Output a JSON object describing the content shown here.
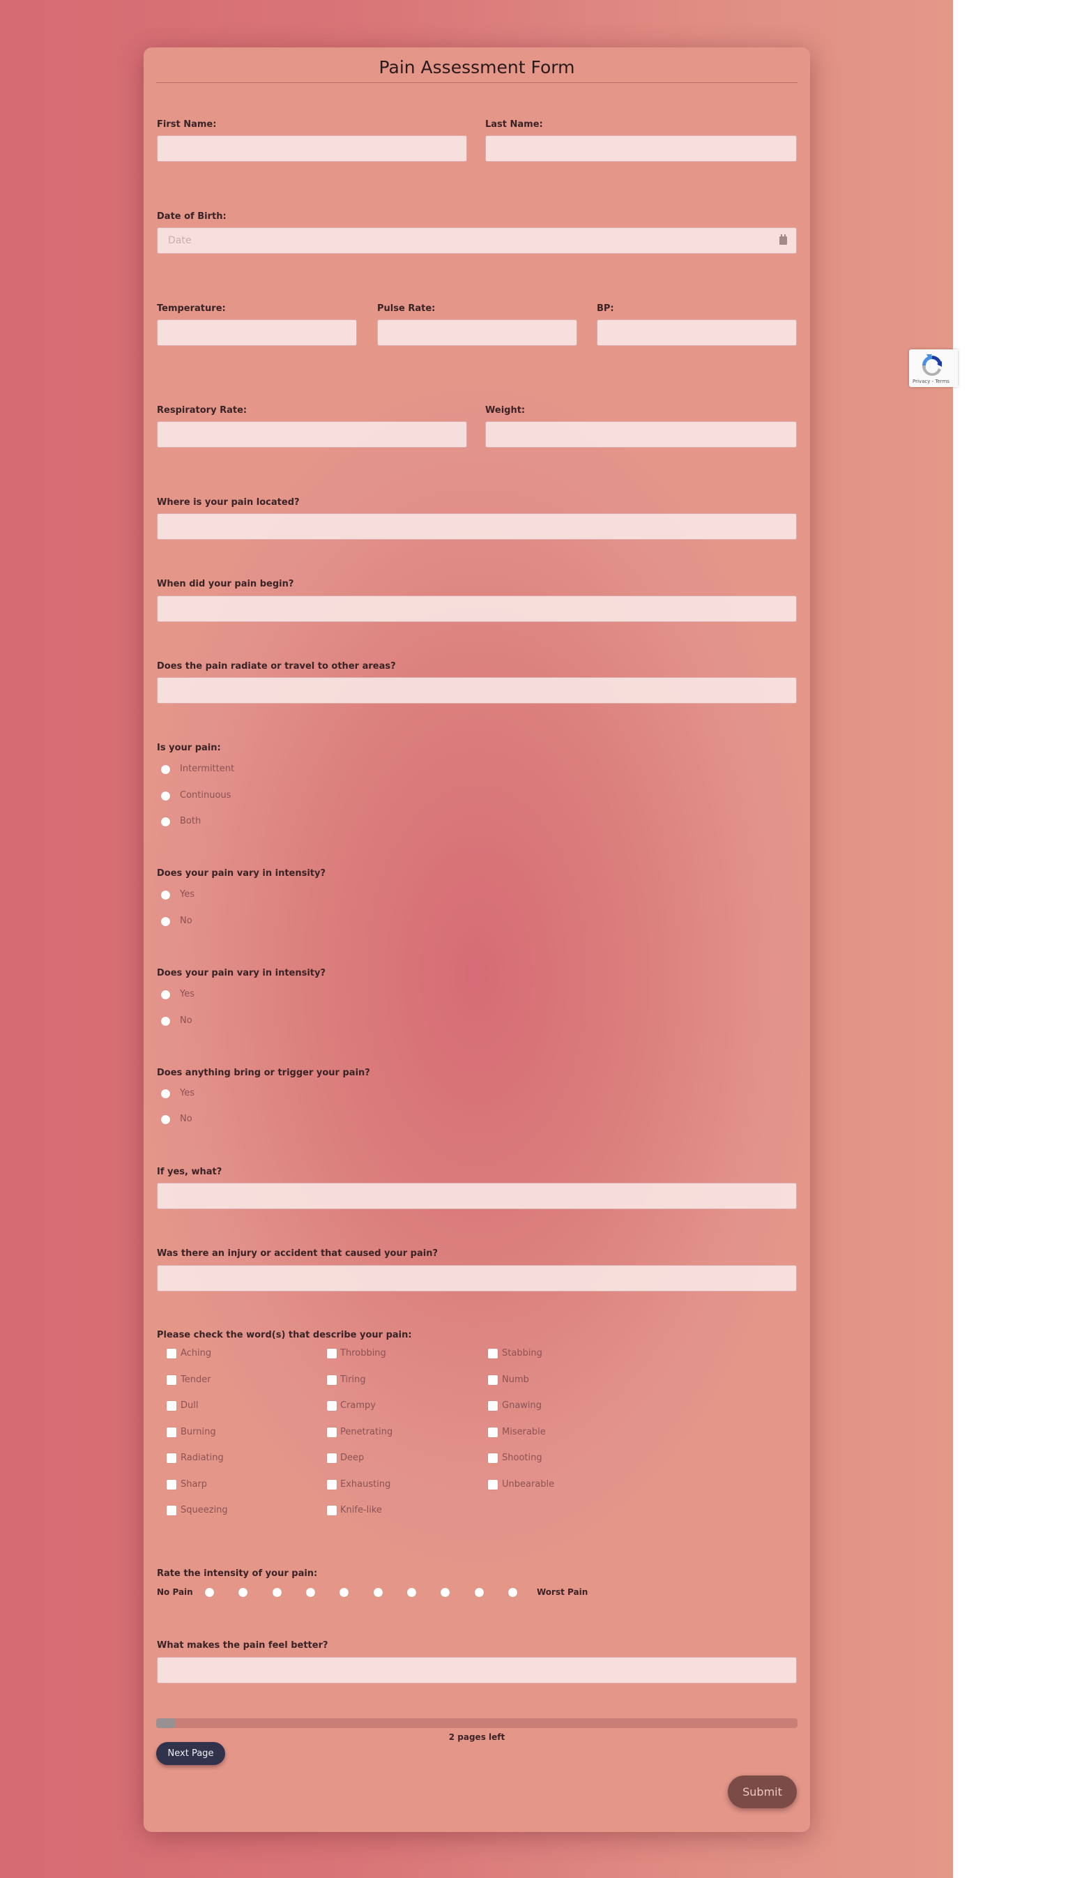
{
  "form": {
    "title": "Pain Assessment Form",
    "fields": {
      "first_name": {
        "label": "First Name:",
        "value": ""
      },
      "last_name": {
        "label": "Last Name:",
        "value": ""
      },
      "dob": {
        "label": "Date of Birth:",
        "placeholder": "Date",
        "value": "",
        "icon": "calendar-icon"
      },
      "temperature": {
        "label": "Temperature:",
        "value": ""
      },
      "pulse_rate": {
        "label": "Pulse Rate:",
        "value": ""
      },
      "bp": {
        "label": "BP:",
        "value": ""
      },
      "respiratory_rate": {
        "label": "Respiratory Rate:",
        "value": ""
      },
      "weight": {
        "label": "Weight:",
        "value": ""
      },
      "pain_location": {
        "label": "Where is your pain located?",
        "value": ""
      },
      "pain_begin": {
        "label": "When did your pain begin?",
        "value": ""
      },
      "pain_radiate": {
        "label": "Does the pain radiate or travel to other areas?",
        "value": ""
      },
      "if_yes_what": {
        "label": "If yes, what?",
        "value": ""
      },
      "injury": {
        "label": "Was there an injury or accident that caused your pain?",
        "value": ""
      },
      "feel_better": {
        "label": "What makes the pain feel better?",
        "value": ""
      }
    },
    "radio_groups": [
      {
        "label": "Is your pain:",
        "options": [
          "Intermittent",
          "Continuous",
          "Both"
        ],
        "selected": null
      },
      {
        "label": "Does your pain vary in intensity?",
        "options": [
          "Yes",
          "No"
        ],
        "selected": null
      },
      {
        "label": "Does your pain vary in intensity?",
        "options": [
          "Yes",
          "No"
        ],
        "selected": null
      },
      {
        "label": "Does anything bring or trigger your pain?",
        "options": [
          "Yes",
          "No"
        ],
        "selected": null
      }
    ],
    "pain_words": {
      "label": "Please check the word(s) that describe your pain:",
      "columns": [
        [
          "Aching",
          "Tender",
          "Dull",
          "Burning",
          "Radiating",
          "Sharp",
          "Squeezing"
        ],
        [
          "Throbbing",
          "Tiring",
          "Crampy",
          "Penetrating",
          "Deep",
          "Exhausting",
          "Knife-like"
        ],
        [
          "Stabbing",
          "Numb",
          "Gnawing",
          "Miserable",
          "Shooting",
          "Unbearable"
        ]
      ],
      "checked": []
    },
    "intensity_scale": {
      "label": "Rate the intensity of your pain:",
      "min_label": "No Pain",
      "max_label": "Worst Pain",
      "points": 10,
      "selected": null
    },
    "progress": {
      "fraction": 0.03,
      "text": "2 pages left"
    },
    "buttons": {
      "next_page": "Next Page",
      "submit": "Submit"
    }
  },
  "recaptcha": {
    "text": "Privacy - Terms"
  },
  "colors": {
    "next_button": "#30334b",
    "submit_button": "#7a4b47",
    "progress_fill": "#989191"
  }
}
